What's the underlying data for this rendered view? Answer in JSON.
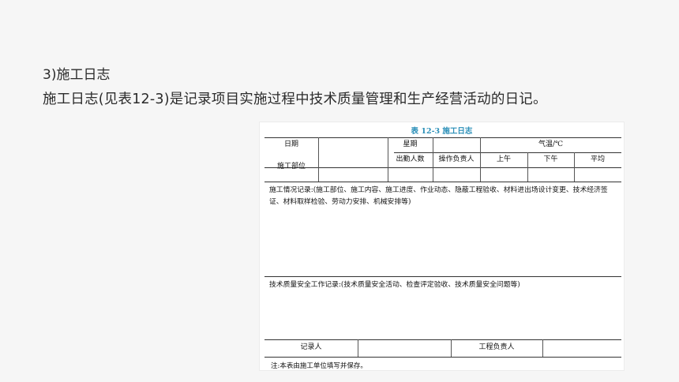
{
  "section": {
    "heading": "3)施工日志",
    "lead": "施工日志(见表12-3)是记录项目实施过程中技术质量管理和生产经营活动的日记。"
  },
  "table": {
    "title": "表 12-3   施工日志",
    "header": {
      "date": "日期",
      "weekday": "星期",
      "temperature": "气温/℃",
      "site": "施工部位",
      "attendance": "出勤人数",
      "operator": "操作负责人",
      "morning": "上午",
      "afternoon": "下午",
      "average": "平均"
    },
    "construction_record": "施工情况记录:(施工部位、施工内容、施工进度、作业动态、隐蔽工程验收、材料进出场设计变更、技术经济签证、材料取样检验、劳动力安排、机械安排等)",
    "quality_record": "技术质量安全工作记录:(技术质量安全活动、检查评定验收、技术质量安全问题等)",
    "footer": {
      "recorder": "记录人",
      "project_lead": "工程负责人"
    },
    "note": "注:本表由施工单位填写并保存。"
  }
}
